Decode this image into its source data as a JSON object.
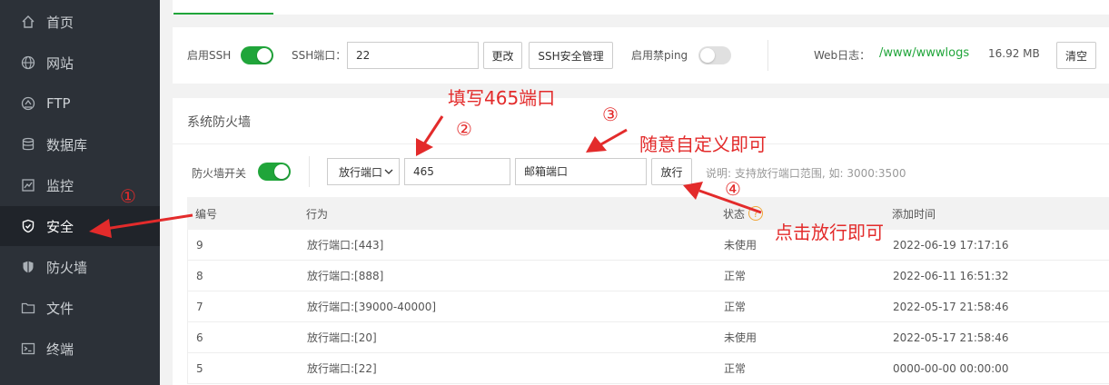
{
  "sidebar": {
    "items": [
      {
        "label": "首页",
        "icon": "home-icon"
      },
      {
        "label": "网站",
        "icon": "globe-icon"
      },
      {
        "label": "FTP",
        "icon": "ftp-icon"
      },
      {
        "label": "数据库",
        "icon": "database-icon"
      },
      {
        "label": "监控",
        "icon": "monitor-icon"
      },
      {
        "label": "安全",
        "icon": "shield-icon",
        "active": true
      },
      {
        "label": "防火墙",
        "icon": "firewall-icon"
      },
      {
        "label": "文件",
        "icon": "folder-icon"
      },
      {
        "label": "终端",
        "icon": "terminal-icon"
      }
    ]
  },
  "ssh": {
    "enable_label": "启用SSH",
    "enable_on": true,
    "port_label": "SSH端口：",
    "port_value": "22",
    "change_button": "更改",
    "manage_button": "SSH安全管理",
    "noping_label": "启用禁ping",
    "noping_on": false,
    "weblog_label": "Web日志：",
    "weblog_path": "/www/wwwlogs",
    "weblog_size": "16.92 MB",
    "clear_button": "清空"
  },
  "firewall": {
    "title": "系统防火墙",
    "switch_label": "防火墙开关",
    "switch_on": true,
    "rule_type": "放行端口",
    "port_value": "465",
    "remark_value": "邮箱端口",
    "allow_button": "放行",
    "hint": "说明: 支持放行端口范围, 如: 3000:3500",
    "columns": [
      "编号",
      "行为",
      "状态",
      "添加时间"
    ],
    "rows": [
      {
        "id": "9",
        "action": "放行端口:[443]",
        "status": "未使用",
        "time": "2022-06-19 17:17:16"
      },
      {
        "id": "8",
        "action": "放行端口:[888]",
        "status": "正常",
        "time": "2022-06-11 16:51:32"
      },
      {
        "id": "7",
        "action": "放行端口:[39000-40000]",
        "status": "正常",
        "time": "2022-05-17 21:58:46"
      },
      {
        "id": "6",
        "action": "放行端口:[20]",
        "status": "未使用",
        "time": "2022-05-17 21:58:46"
      },
      {
        "id": "5",
        "action": "放行端口:[22]",
        "status": "正常",
        "time": "0000-00-00 00:00:00"
      }
    ]
  },
  "annotations": {
    "step1": "①",
    "step2": "②",
    "step3": "③",
    "step4": "④",
    "note_port": "填写465端口",
    "note_remark": "随意自定义即可",
    "note_allow": "点击放行即可"
  },
  "colors": {
    "accent": "#20a53a",
    "annotation": "#e32b2b",
    "sidebar_bg": "#2c3138"
  }
}
